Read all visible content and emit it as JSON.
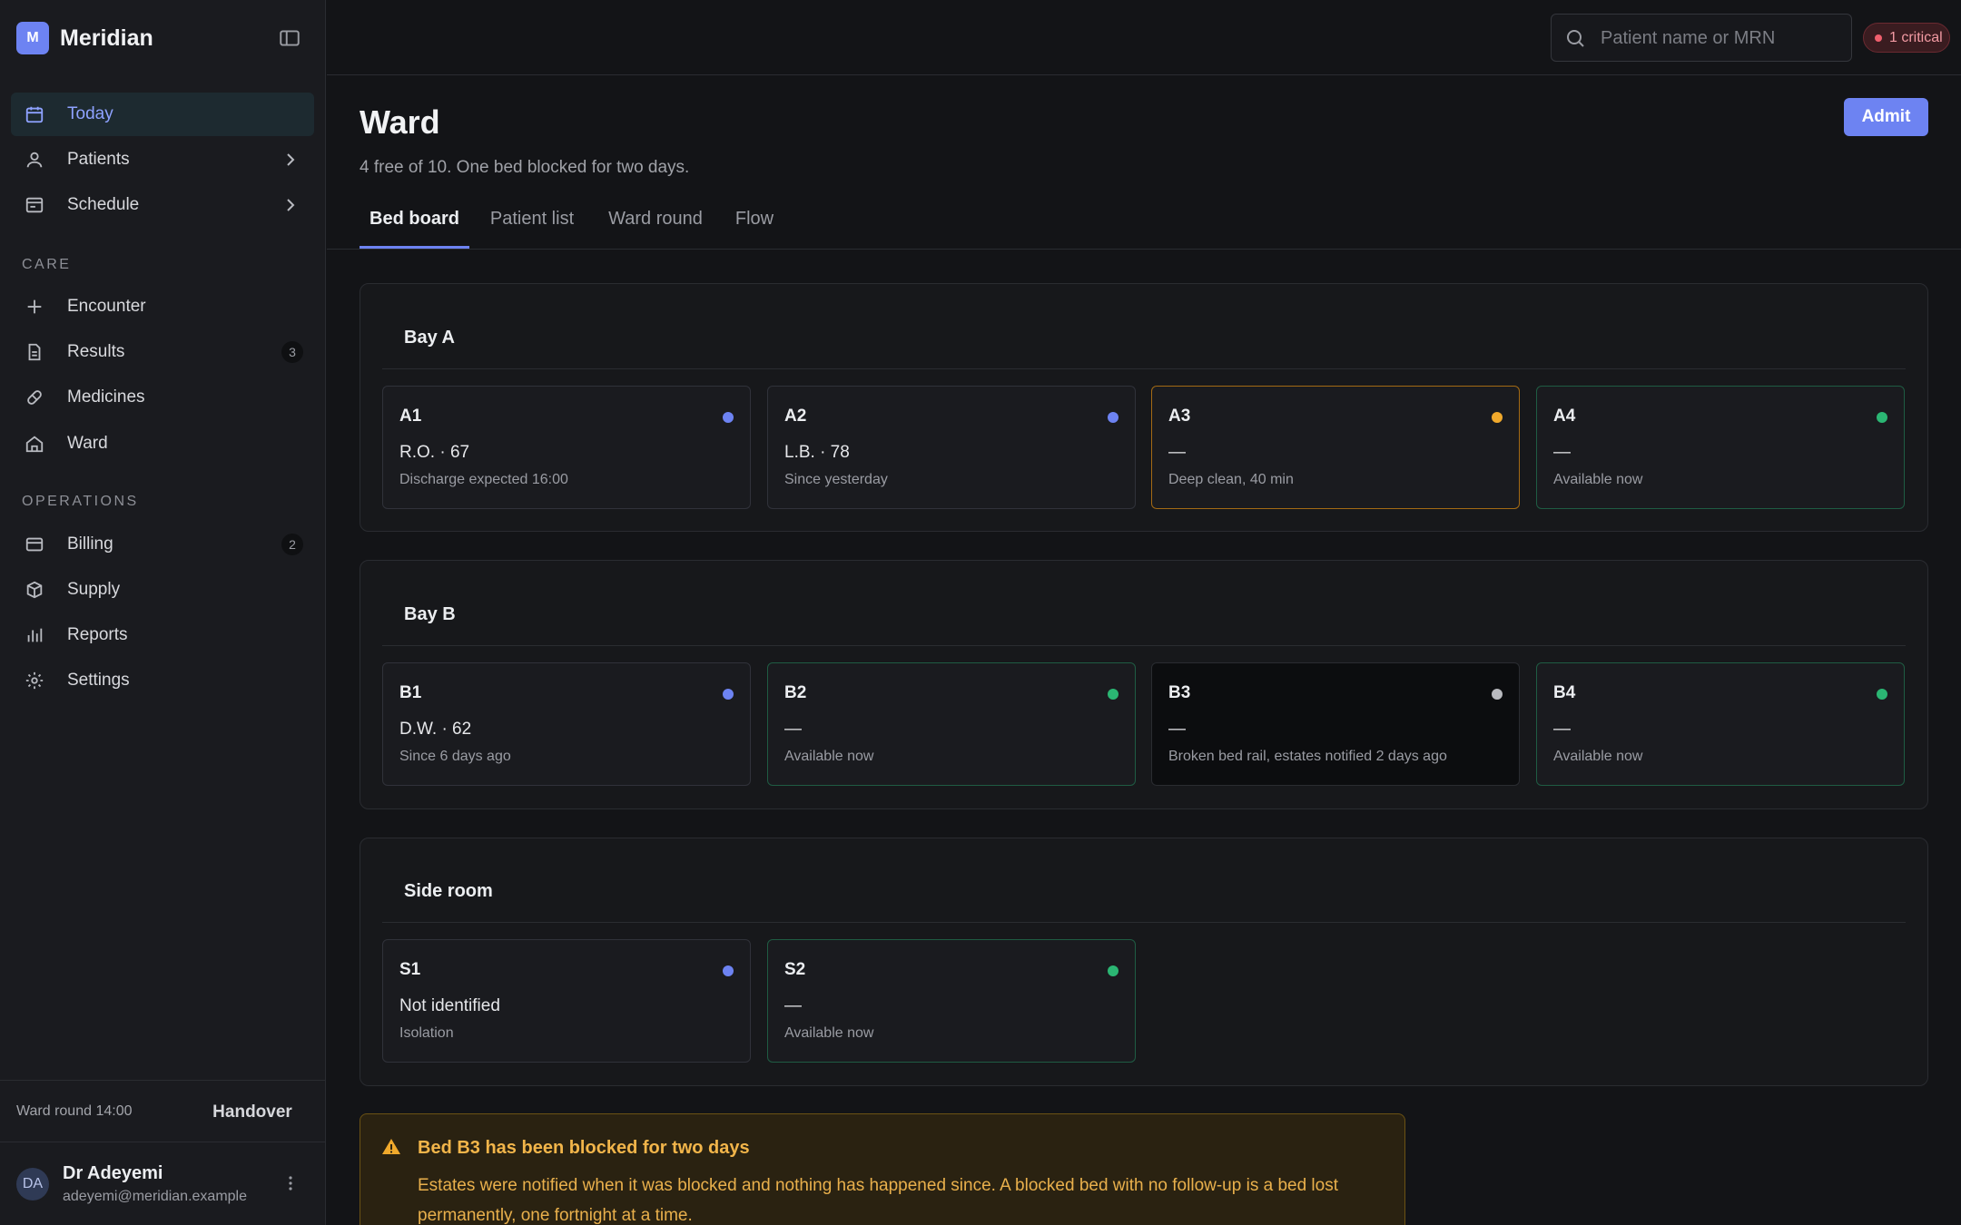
{
  "app": {
    "logo_letter": "M",
    "name": "Meridian"
  },
  "sidebar": {
    "primary": [
      {
        "label": "Today",
        "icon": "calendar-icon",
        "active": true
      },
      {
        "label": "Patients",
        "icon": "user-icon",
        "has_submenu": true
      },
      {
        "label": "Schedule",
        "icon": "schedule-icon",
        "has_submenu": true
      }
    ],
    "care_label": "CARE",
    "care": [
      {
        "label": "Encounter",
        "icon": "plus-icon"
      },
      {
        "label": "Results",
        "icon": "document-icon",
        "badge": "3"
      },
      {
        "label": "Medicines",
        "icon": "pill-icon"
      },
      {
        "label": "Ward",
        "icon": "ward-icon"
      }
    ],
    "operations_label": "OPERATIONS",
    "operations": [
      {
        "label": "Billing",
        "icon": "card-icon",
        "badge": "2"
      },
      {
        "label": "Supply",
        "icon": "box-icon"
      },
      {
        "label": "Reports",
        "icon": "bar-chart-icon"
      },
      {
        "label": "Settings",
        "icon": "gear-icon"
      }
    ],
    "footer": {
      "round_label": "Ward round 14:00",
      "handover_label": "Handover",
      "user_initials": "DA",
      "user_name": "Dr Adeyemi",
      "user_email": "adeyemi@meridian.example"
    }
  },
  "topbar": {
    "search_placeholder": "Patient name or MRN",
    "critical_label": "1 critical"
  },
  "page": {
    "title": "Ward",
    "subtitle": "4 free of 10. One bed blocked for two days.",
    "admit_label": "Admit",
    "tabs": [
      "Bed board",
      "Patient list",
      "Ward round",
      "Flow"
    ]
  },
  "colors": {
    "occupied": "#6d83f2",
    "free": "#2bb673",
    "cleaning": "#f0a92c",
    "blocked": "#b9babf"
  },
  "bays": [
    {
      "name": "Bay A",
      "beds": [
        {
          "id": "A1",
          "patient": "R.O. · 67",
          "note": "Discharge expected 16:00",
          "status": "occupied"
        },
        {
          "id": "A2",
          "patient": "L.B. · 78",
          "note": "Since yesterday",
          "status": "occupied"
        },
        {
          "id": "A3",
          "patient": "—",
          "note": "Deep clean, 40 min",
          "status": "cleaning"
        },
        {
          "id": "A4",
          "patient": "—",
          "note": "Available now",
          "status": "free"
        }
      ]
    },
    {
      "name": "Bay B",
      "beds": [
        {
          "id": "B1",
          "patient": "D.W. · 62",
          "note": "Since 6 days ago",
          "status": "occupied"
        },
        {
          "id": "B2",
          "patient": "—",
          "note": "Available now",
          "status": "free"
        },
        {
          "id": "B3",
          "patient": "—",
          "note": "Broken bed rail, estates notified 2 days ago",
          "status": "blocked"
        },
        {
          "id": "B4",
          "patient": "—",
          "note": "Available now",
          "status": "free"
        }
      ]
    },
    {
      "name": "Side room",
      "beds": [
        {
          "id": "S1",
          "patient": "Not identified",
          "note": "Isolation",
          "status": "occupied"
        },
        {
          "id": "S2",
          "patient": "—",
          "note": "Available now",
          "status": "free"
        }
      ]
    }
  ],
  "alert": {
    "title": "Bed B3 has been blocked for two days",
    "body": "Estates were notified when it was blocked and nothing has happened since. A blocked bed with no follow-up is a bed lost permanently, one fortnight at a time."
  }
}
